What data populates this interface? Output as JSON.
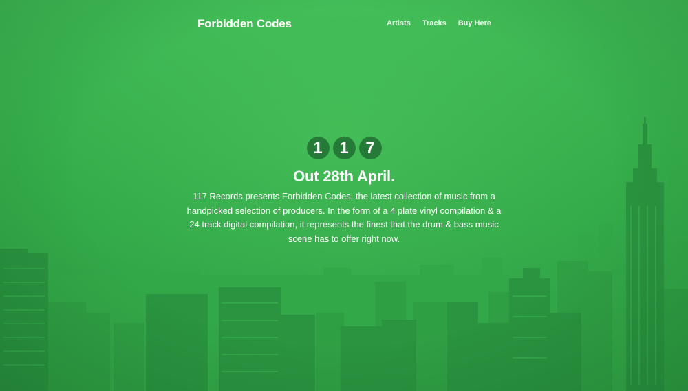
{
  "header": {
    "brand": "Forbidden Codes",
    "nav": [
      {
        "label": "Artists"
      },
      {
        "label": "Tracks"
      },
      {
        "label": "Buy Here"
      }
    ]
  },
  "hero": {
    "digits": [
      "1",
      "1",
      "7"
    ],
    "headline": "Out 28th April.",
    "description": "117 Records presents Forbidden Codes, the latest collection of music from a handpicked selection of producers. In the form of a 4 plate vinyl compilation & a 24 track digital compilation, it represents the finest that the drum & bass music scene has to offer right now."
  },
  "colors": {
    "overlay_green": "#37b24d",
    "digit_badge": "#257a38",
    "text": "#ffffff"
  }
}
